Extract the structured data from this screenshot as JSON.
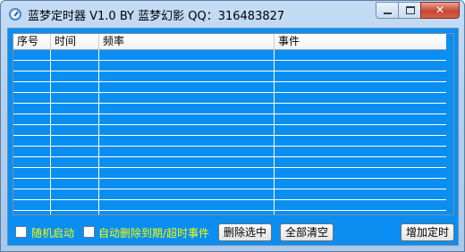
{
  "window": {
    "title": "蓝梦定时器 V1.0 BY 蓝梦幻影 QQ：316483827",
    "controls": {
      "minimize": "minimize",
      "maximize": "maximize",
      "close": "✕"
    }
  },
  "list": {
    "columns": [
      "序号",
      "时间",
      "频率",
      "事件"
    ],
    "rows": []
  },
  "options": {
    "auto_start_label": "随机启动",
    "auto_start_checked": false,
    "auto_delete_label": "自动删除到期/超时事件",
    "auto_delete_checked": false
  },
  "buttons": {
    "delete_selected": "删除选中",
    "clear_all": "全部清空",
    "add_timer": "增加定时"
  },
  "colors": {
    "client_bg": "#0a8ef1",
    "option_text": "#f2ff00"
  }
}
